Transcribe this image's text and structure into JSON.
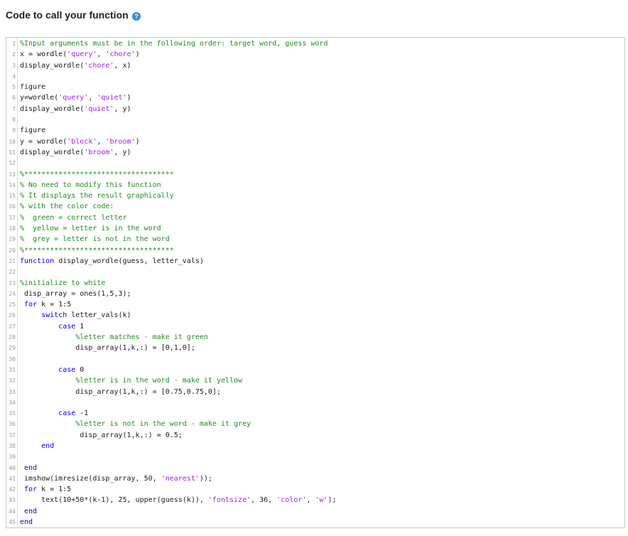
{
  "header": {
    "title": "Code to call your function",
    "help_icon": "question-circle-icon"
  },
  "colors": {
    "comment": "#228b22",
    "keyword": "#0000ff",
    "string": "#a020f0",
    "help_icon": "#3b8fc8"
  },
  "code_lines": [
    [
      [
        "cm",
        "%Input arguments must be in the following order: target word, guess word"
      ]
    ],
    [
      [
        "",
        "x = wordle("
      ],
      [
        "st",
        "'query'"
      ],
      [
        "",
        ", "
      ],
      [
        "st",
        "'chore'"
      ],
      [
        "",
        ")"
      ]
    ],
    [
      [
        "",
        "display_wordle("
      ],
      [
        "st",
        "'chore'"
      ],
      [
        "",
        ", x)"
      ]
    ],
    [],
    [
      [
        "",
        "figure"
      ]
    ],
    [
      [
        "",
        "y=wordle("
      ],
      [
        "st",
        "'query'"
      ],
      [
        "",
        ", "
      ],
      [
        "st",
        "'quiet'"
      ],
      [
        "",
        ")"
      ]
    ],
    [
      [
        "",
        "display_wordle("
      ],
      [
        "st",
        "'quiet'"
      ],
      [
        "",
        ", y)"
      ]
    ],
    [],
    [
      [
        "",
        "figure"
      ]
    ],
    [
      [
        "",
        "y = wordle("
      ],
      [
        "st",
        "'block'"
      ],
      [
        "",
        ", "
      ],
      [
        "st",
        "'broom'"
      ],
      [
        "",
        ")"
      ]
    ],
    [
      [
        "",
        "display_wordle("
      ],
      [
        "st",
        "'broom'"
      ],
      [
        "",
        ", y)"
      ]
    ],
    [],
    [
      [
        "cm",
        "%***********************************"
      ]
    ],
    [
      [
        "cm",
        "% No need to modify this function"
      ]
    ],
    [
      [
        "cm",
        "% It displays the result graphically"
      ]
    ],
    [
      [
        "cm",
        "% with the color code:"
      ]
    ],
    [
      [
        "cm",
        "%  green = correct letter"
      ]
    ],
    [
      [
        "cm",
        "%  yellow = letter is in the word"
      ]
    ],
    [
      [
        "cm",
        "%  grey = letter is not in the word"
      ]
    ],
    [
      [
        "cm",
        "%***********************************"
      ]
    ],
    [
      [
        "kw",
        "function"
      ],
      [
        "",
        " display_wordle(guess, letter_vals)"
      ]
    ],
    [],
    [
      [
        "cm",
        "%initialize to white"
      ]
    ],
    [
      [
        "",
        " disp_array = ones(1,5,3);"
      ]
    ],
    [
      [
        "kw",
        " for"
      ],
      [
        "",
        " k = 1:5"
      ]
    ],
    [
      [
        "kw",
        "     switch"
      ],
      [
        "",
        " letter_vals(k)"
      ]
    ],
    [
      [
        "kw",
        "         case"
      ],
      [
        "",
        " 1"
      ]
    ],
    [
      [
        "cm",
        "             %letter matches - make it green"
      ]
    ],
    [
      [
        "",
        "             disp_array(1,k,:) = [0,1,0];"
      ]
    ],
    [],
    [
      [
        "kw",
        "         case"
      ],
      [
        "",
        " 0"
      ]
    ],
    [
      [
        "cm",
        "             %letter is in the word - make it yellow"
      ]
    ],
    [
      [
        "",
        "             disp_array(1,k,:) = [0.75,0.75,0];"
      ]
    ],
    [],
    [
      [
        "kw",
        "         case"
      ],
      [
        "",
        " -1"
      ]
    ],
    [
      [
        "cm",
        "             %letter is not in the word - make it grey"
      ]
    ],
    [
      [
        "",
        "              disp_array(1,k,:) = 0.5;"
      ]
    ],
    [
      [
        "kw",
        "     end"
      ]
    ],
    [],
    [
      [
        "kw",
        " end"
      ]
    ],
    [
      [
        "",
        " imshow(imresize(disp_array, 50, "
      ],
      [
        "st",
        "'nearest'"
      ],
      [
        "",
        "));"
      ]
    ],
    [
      [
        "kw",
        " for"
      ],
      [
        "",
        " k = 1:5"
      ]
    ],
    [
      [
        "",
        "     text(10+50*(k-1), 25, upper(guess(k)), "
      ],
      [
        "st",
        "'fontsize'"
      ],
      [
        "",
        ", 36, "
      ],
      [
        "st",
        "'color'"
      ],
      [
        "",
        ", "
      ],
      [
        "st",
        "'w'"
      ],
      [
        "",
        ");"
      ]
    ],
    [
      [
        "kw",
        " end"
      ]
    ],
    [
      [
        "kw",
        "end"
      ]
    ]
  ]
}
